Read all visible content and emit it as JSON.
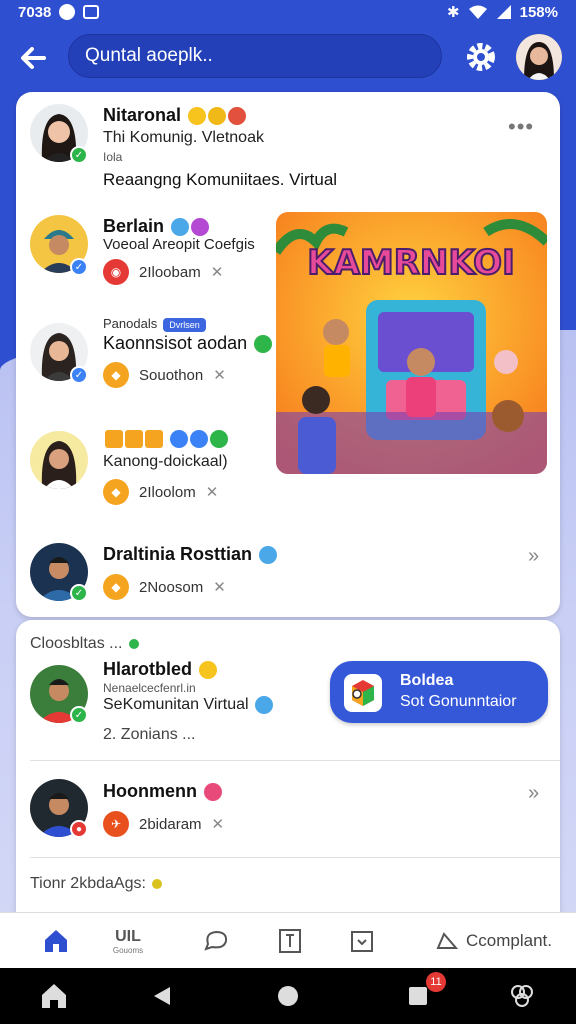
{
  "status_bar": {
    "time": "7038",
    "battery": "158%"
  },
  "search": {
    "placeholder": "Quntal aoeplk.."
  },
  "featured": {
    "author_name": "Nitaronal",
    "author_subtitle": "Thi Komunig. Vletnoak",
    "author_small": "Iola",
    "post_title": "Reaangng Komuniitaes. Virtual"
  },
  "list": [
    {
      "name": "Berlain",
      "subtitle": "Voeoal Areopit Coefgis",
      "meta": "2Iloobam",
      "meta_color": "#e53935"
    },
    {
      "name_prefix": "Panodals",
      "pill": "Dvrlsen",
      "name": "Kaonnsisot aodan",
      "name_suffix": "...",
      "meta": "Souothon",
      "meta_color": "#f4a41e"
    },
    {
      "name": "Kanong-doickaal)",
      "meta": "2Iloolom",
      "meta_color": "#f4a41e"
    },
    {
      "name": "Draltinia Rosttian",
      "meta": "2Noosom",
      "meta_color": "#f4a41e"
    }
  ],
  "game_image": {
    "caption": "KAMRNKOI"
  },
  "section2": {
    "header": "Cloosbltas ...",
    "item1": {
      "name": "Hlarotbled",
      "small": "Nenaelcecfenrl.in",
      "subtitle": "SeKomunitan Virtual",
      "extra": "2.  Zonians ..."
    },
    "cta": {
      "line1": "Boldea",
      "line2": "Sot Gonunntaior"
    },
    "item2": {
      "name": "Hoonmenn",
      "meta": "2bidaram",
      "meta_color": "#e8501e"
    },
    "footer_header": "Tionr 2kbdaAgs:"
  },
  "tabs": [
    {
      "label": "",
      "icon": "home-icon"
    },
    {
      "label": "UIL",
      "sub": "Gouoms",
      "icon": "groups-icon"
    },
    {
      "label": "",
      "icon": "chat-icon"
    },
    {
      "label": "",
      "icon": "notebook-icon"
    },
    {
      "label": "",
      "icon": "inbox-icon"
    },
    {
      "label": "Ccomplant.",
      "icon": "bell-icon"
    }
  ],
  "nav": {
    "badge": "11"
  },
  "colors": {
    "primary": "#2f4fd1",
    "accent": "#3558d9"
  }
}
